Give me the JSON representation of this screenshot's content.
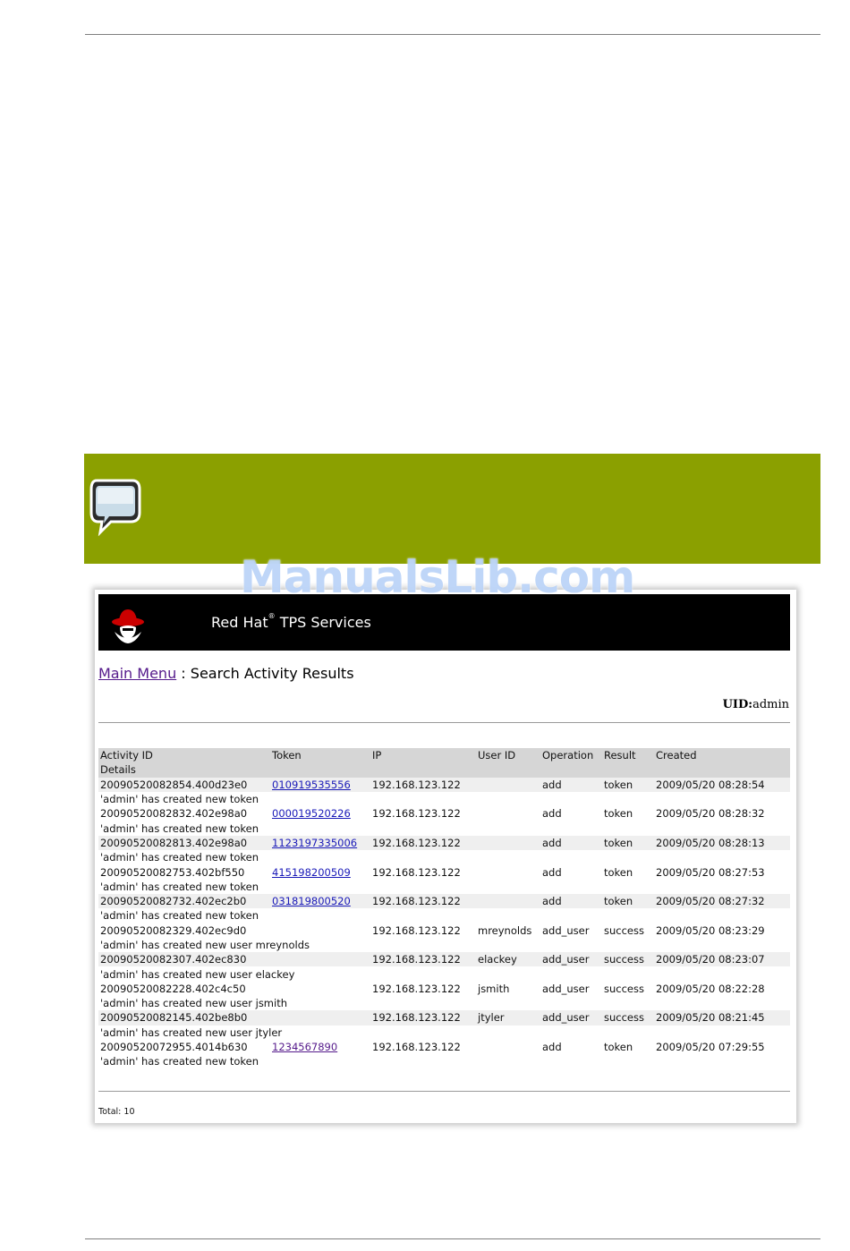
{
  "watermark": "ManualsLib.com",
  "screenshot": {
    "app_title": "Red Hat",
    "app_title_mark": "®",
    "app_title_suffix": "TPS Services",
    "breadcrumb": {
      "link": "Main Menu",
      "separator": " : ",
      "current": "Search Activity Results"
    },
    "uid": {
      "label": "UID:",
      "value": "admin"
    },
    "columns": [
      "Activity ID",
      "Token",
      "IP",
      "User ID",
      "Operation",
      "Result",
      "Created"
    ],
    "details_header": "Details",
    "rows": [
      {
        "activity_id": "20090520082854.400d23e0",
        "token": "010919535556",
        "ip": "192.168.123.122",
        "user_id": "",
        "operation": "add",
        "result": "token",
        "created": "2009/05/20 08:28:54",
        "details": "'admin' has created new token"
      },
      {
        "activity_id": "20090520082832.402e98a0",
        "token": "000019520226",
        "ip": "192.168.123.122",
        "user_id": "",
        "operation": "add",
        "result": "token",
        "created": "2009/05/20 08:28:32",
        "details": "'admin' has created new token"
      },
      {
        "activity_id": "20090520082813.402e98a0",
        "token": "1123197335006",
        "ip": "192.168.123.122",
        "user_id": "",
        "operation": "add",
        "result": "token",
        "created": "2009/05/20 08:28:13",
        "details": "'admin' has created new token"
      },
      {
        "activity_id": "20090520082753.402bf550",
        "token": "415198200509",
        "ip": "192.168.123.122",
        "user_id": "",
        "operation": "add",
        "result": "token",
        "created": "2009/05/20 08:27:53",
        "details": "'admin' has created new token"
      },
      {
        "activity_id": "20090520082732.402ec2b0",
        "token": "031819800520",
        "ip": "192.168.123.122",
        "user_id": "",
        "operation": "add",
        "result": "token",
        "created": "2009/05/20 08:27:32",
        "details": "'admin' has created new token"
      },
      {
        "activity_id": "20090520082329.402ec9d0",
        "token": "",
        "ip": "192.168.123.122",
        "user_id": "mreynolds",
        "operation": "add_user",
        "result": "success",
        "created": "2009/05/20 08:23:29",
        "details": "'admin' has created new user mreynolds"
      },
      {
        "activity_id": "20090520082307.402ec830",
        "token": "",
        "ip": "192.168.123.122",
        "user_id": "elackey",
        "operation": "add_user",
        "result": "success",
        "created": "2009/05/20 08:23:07",
        "details": "'admin' has created new user elackey"
      },
      {
        "activity_id": "20090520082228.402c4c50",
        "token": "",
        "ip": "192.168.123.122",
        "user_id": "jsmith",
        "operation": "add_user",
        "result": "success",
        "created": "2009/05/20 08:22:28",
        "details": "'admin' has created new user jsmith"
      },
      {
        "activity_id": "20090520082145.402be8b0",
        "token": "",
        "ip": "192.168.123.122",
        "user_id": "jtyler",
        "operation": "add_user",
        "result": "success",
        "created": "2009/05/20 08:21:45",
        "details": "'admin' has created new user jtyler"
      },
      {
        "activity_id": "20090520072955.4014b630",
        "token": "1234567890",
        "ip": "192.168.123.122",
        "user_id": "",
        "operation": "add",
        "result": "token",
        "created": "2009/05/20 07:29:55",
        "details": "'admin' has created new token"
      }
    ],
    "total": "Total: 10"
  },
  "colors": {
    "note_green": "#8ba000",
    "header_black": "#000000",
    "logo_red": "#cc0000"
  },
  "icons": {
    "note": "speech-bubble-icon",
    "logo": "redhat-shadowman-icon"
  }
}
